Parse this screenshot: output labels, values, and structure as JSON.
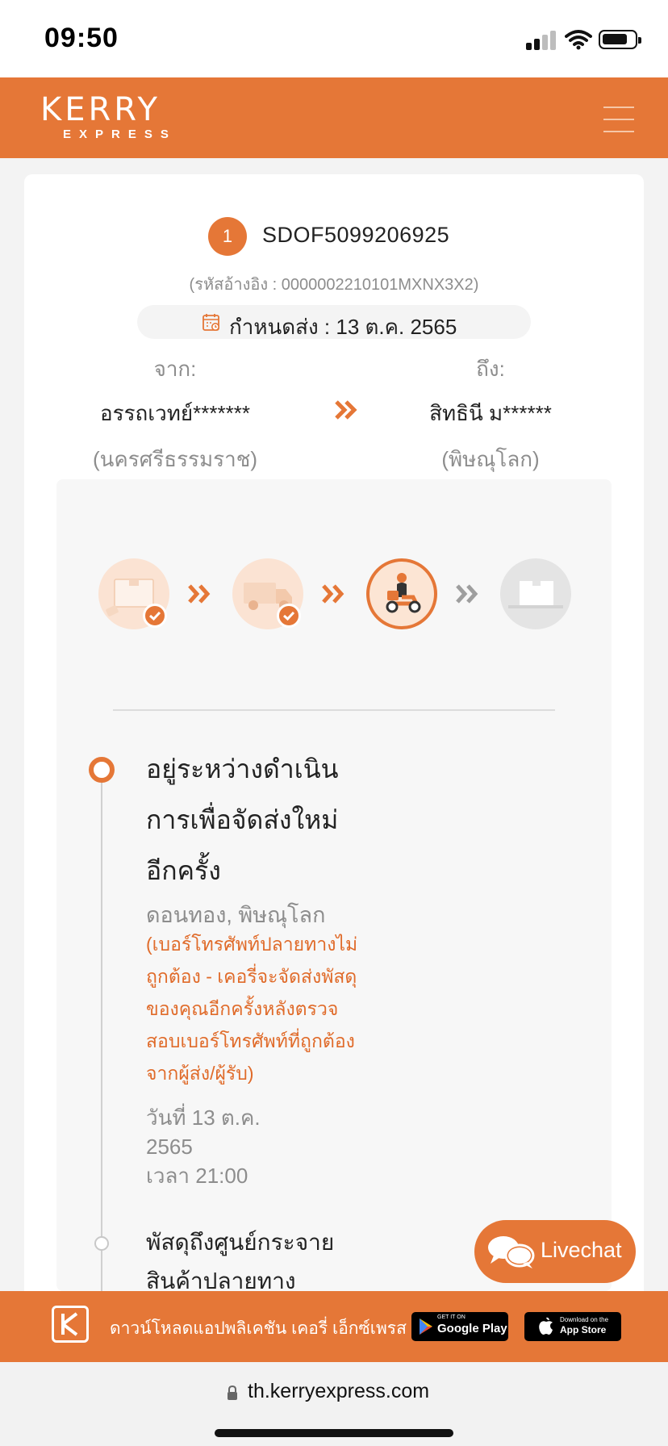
{
  "status_bar": {
    "time": "09:50"
  },
  "header": {
    "logo_main": "KERRY",
    "logo_sub": "EXPRESS",
    "menu_icon": "hamburger-menu-icon"
  },
  "shipment": {
    "index": "1",
    "tracking_number": "SDOF5099206925",
    "reference": "(รหัสอ้างอิง : 0000002210101MXNX3X2)",
    "due_date": "กำหนดส่ง : 13 ต.ค. 2565",
    "from_label": "จาก:",
    "from_name": "อรรถเวทย์*******",
    "from_place": "(นครศรีธรรมราช)",
    "to_label": "ถึง:",
    "to_name": "สิทธินี ม******",
    "to_place": "(พิษณุโลก)"
  },
  "progress": {
    "steps_total": 4,
    "steps_completed": 2,
    "current_step": 3
  },
  "timeline": [
    {
      "title": "อยู่ระหว่างดำเนินการเพื่อจัดส่งใหม่อีกครั้ง",
      "location": "ดอนทอง, พิษณุโลก",
      "note": "(เบอร์โทรศัพท์ปลายทางไม่ถูกต้อง - เคอรี่จะจัดส่งพัสดุของคุณอีกครั้งหลังตรวจสอบเบอร์โทรศัพท์ที่ถูกต้องจากผู้ส่ง/ผู้รับ)",
      "date": "วันที่ 13 ต.ค. 2565",
      "time": "เวลา 21:00"
    },
    {
      "title": "พัสดุถึงศูนย์กระจายสินค้าปลายทาง"
    }
  ],
  "livechat": {
    "label": "Livechat"
  },
  "app_banner": {
    "text": "ดาวน์โหลดแอปพลิเคชัน เคอรี่ เอ็กซ์เพรส",
    "google_small": "GET IT ON",
    "google_big": "Google Play",
    "apple_small": "Download on the",
    "apple_big": "App Store"
  },
  "browser": {
    "url": "th.kerryexpress.com"
  },
  "colors": {
    "brand": "#e57737",
    "note": "#e06b2a",
    "muted": "#8d8d8d"
  }
}
